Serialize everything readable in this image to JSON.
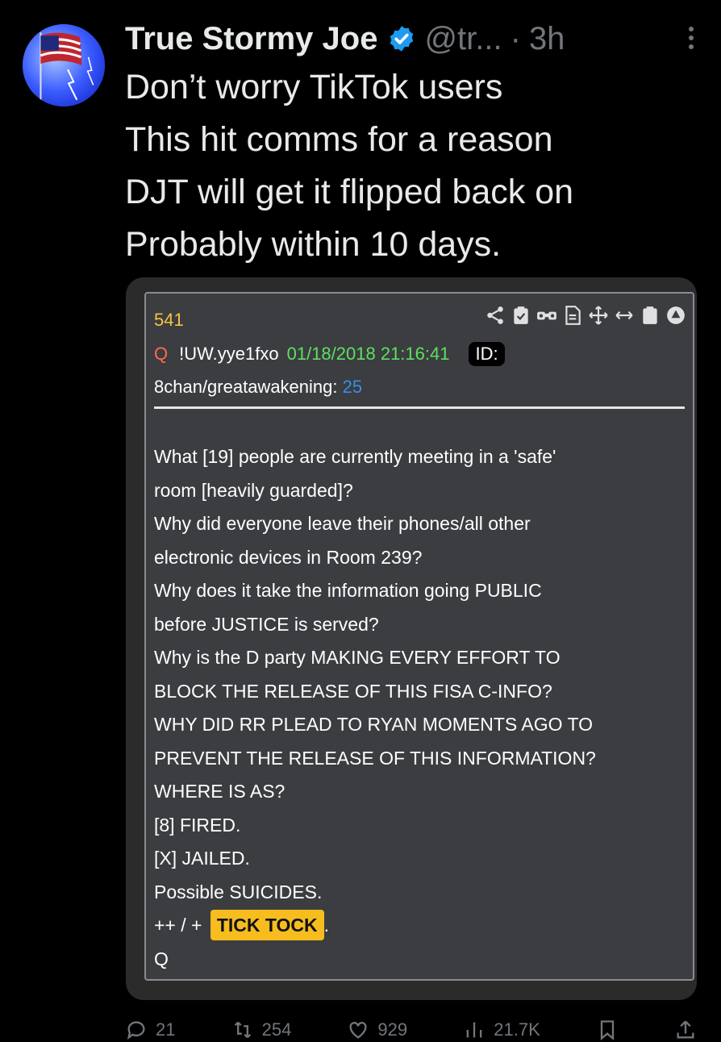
{
  "author": {
    "name": "True Stormy Joe",
    "handle": "@tr...",
    "time": "3h",
    "verified_color": "#1d9bf0"
  },
  "tweet": {
    "lines": [
      "Don’t worry TikTok users",
      "This hit comms for a reason",
      "DJT will get it flipped back on",
      "Probably within 10 days."
    ]
  },
  "qpost": {
    "number": "541",
    "author": "Q",
    "tripcode": "!UW.yye1fxo",
    "datetime": "01/18/2018 21:16:41",
    "id_label": "ID:",
    "board": "8chan/greatawakening:",
    "board_count": "25",
    "body_lines": [
      "What [19] people are currently meeting in a 'safe'",
      "room [heavily guarded]?",
      "Why did everyone leave their phones/all other",
      "electronic devices in Room 239?",
      "Why does it take the information going PUBLIC",
      "before JUSTICE is served?",
      "Why is the D party MAKING EVERY EFFORT TO",
      "BLOCK THE RELEASE OF THIS FISA C-INFO?",
      "WHY DID RR PLEAD TO RYAN MOMENTS AGO TO",
      "PREVENT THE RELEASE OF THIS INFORMATION?",
      "WHERE IS AS?",
      "[8] FIRED.",
      "[X] JAILED.",
      "Possible SUICIDES."
    ],
    "tick_prefix": "++ / +",
    "tick_label": "TICK TOCK",
    "tick_suffix": ".",
    "signature": "Q",
    "icons": [
      "share-icon",
      "clipboard-check-icon",
      "binoculars-icon",
      "document-icon",
      "move-icon",
      "resize-horizontal-icon",
      "clipboard-icon",
      "arrow-up-circle-icon"
    ],
    "colors": {
      "number": "#f5c242",
      "author": "#ff6a4d",
      "date": "#5de05d",
      "count": "#3b8de8",
      "highlight": "#f7bd1e"
    }
  },
  "actions": {
    "reply_count": "21",
    "repost_count": "254",
    "like_count": "929",
    "views_count": "21.7K"
  }
}
